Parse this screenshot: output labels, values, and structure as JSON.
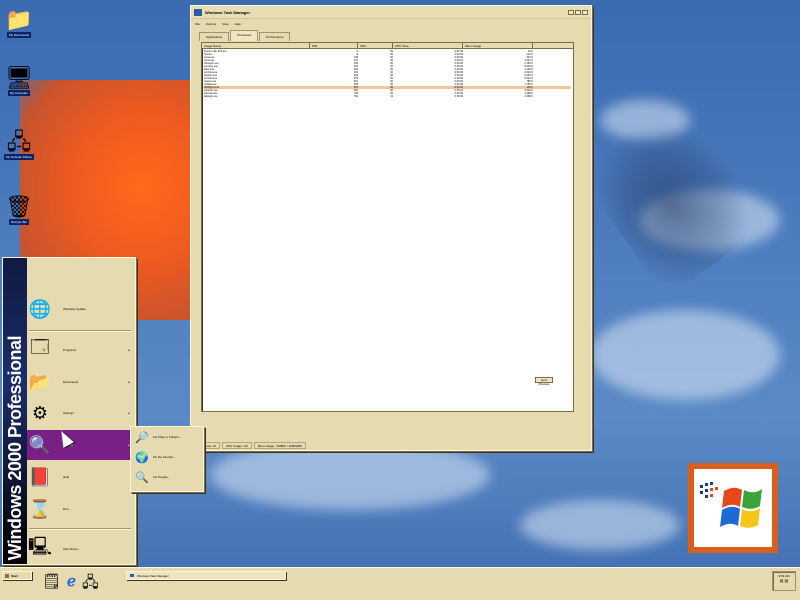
{
  "desktop": {
    "icons": [
      {
        "icon": "folder-icon",
        "glyph": "📁",
        "label": "My Documents"
      },
      {
        "icon": "computer-icon",
        "glyph": "🖥",
        "label": "My Computer"
      },
      {
        "icon": "network-icon",
        "glyph": "🖧",
        "label": "My Network Places"
      },
      {
        "icon": "recycle-bin-icon",
        "glyph": "🗑",
        "label": "Recycle Bin"
      }
    ]
  },
  "window": {
    "title": "Windows Task Manager",
    "menu": [
      "File",
      "Options",
      "View",
      "Help"
    ],
    "tabs": [
      "Applications",
      "Processes",
      "Performance"
    ],
    "columns": [
      "Image Name",
      "PID",
      "CPU",
      "CPU Time",
      "Mem Usage"
    ],
    "processes": [
      {
        "name": "System Idle Process",
        "pid": "0",
        "cpu": "99",
        "time": "0:01:58",
        "mem": "16 K"
      },
      {
        "name": "System",
        "pid": "8",
        "cpu": "00",
        "time": "0:00:02",
        "mem": "212 K"
      },
      {
        "name": "smss.exe",
        "pid": "148",
        "cpu": "00",
        "time": "0:00:00",
        "mem": "344 K"
      },
      {
        "name": "csrss.exe",
        "pid": "172",
        "cpu": "00",
        "time": "0:00:01",
        "mem": "1,424 K"
      },
      {
        "name": "winlogon.exe",
        "pid": "192",
        "cpu": "00",
        "time": "0:00:00",
        "mem": "2,184 K"
      },
      {
        "name": "services.exe",
        "pid": "220",
        "cpu": "00",
        "time": "0:00:00",
        "mem": "5,604 K"
      },
      {
        "name": "lsass.exe",
        "pid": "232",
        "cpu": "00",
        "time": "0:00:00",
        "mem": "1,136 K"
      },
      {
        "name": "svchost.exe",
        "pid": "400",
        "cpu": "00",
        "time": "0:00:00",
        "mem": "3,044 K"
      },
      {
        "name": "spoolsv.exe",
        "pid": "432",
        "cpu": "00",
        "time": "0:00:00",
        "mem": "3,264 K"
      },
      {
        "name": "svchost.exe",
        "pid": "476",
        "cpu": "00",
        "time": "0:00:00",
        "mem": "5,524 K"
      },
      {
        "name": "regsvc.exe",
        "pid": "512",
        "cpu": "00",
        "time": "0:00:00",
        "mem": "780 K"
      },
      {
        "name": "mstask.exe",
        "pid": "528",
        "cpu": "00",
        "time": "0:00:00",
        "mem": "1,756 K"
      },
      {
        "name": "WinMgmt.exe",
        "pid": "576",
        "cpu": "00",
        "time": "0:00:00",
        "mem": "136 K"
      },
      {
        "name": "explorer.exe",
        "pid": "640",
        "cpu": "00",
        "time": "0:00:01",
        "mem": "3,644 K"
      },
      {
        "name": "internat.exe",
        "pid": "736",
        "cpu": "00",
        "time": "0:00:00",
        "mem": "1,368 K"
      },
      {
        "name": "taskmgr.exe",
        "pid": "752",
        "cpu": "01",
        "time": "0:00:00",
        "mem": "2,008 K"
      }
    ],
    "end_process_label": "End Process",
    "status": [
      "Processes: 16",
      "CPU Usage: 1%",
      "Mem Usage: 74080K / 1180328K"
    ]
  },
  "start_menu": {
    "banner": "Windows 2000 Professional",
    "items": [
      {
        "icon": "windows-update-icon",
        "glyph": "🌐",
        "label": "Windows Update",
        "arrow": ""
      },
      {
        "icon": "programs-icon",
        "glyph": "🗔",
        "label": "Programs",
        "arrow": "▸"
      },
      {
        "icon": "documents-icon",
        "glyph": "📂",
        "label": "Documents",
        "arrow": "▸"
      },
      {
        "icon": "settings-icon",
        "glyph": "⚙",
        "label": "Settings",
        "arrow": "▸"
      },
      {
        "icon": "search-icon",
        "glyph": "🔍",
        "label": "Search",
        "arrow": "▸"
      },
      {
        "icon": "help-icon",
        "glyph": "📕",
        "label": "Help",
        "arrow": ""
      },
      {
        "icon": "run-icon",
        "glyph": "⌛",
        "label": "Run...",
        "arrow": ""
      },
      {
        "icon": "shutdown-icon",
        "glyph": "🖳",
        "label": "Shut Down...",
        "arrow": ""
      }
    ],
    "search_submenu": [
      {
        "icon": "search-files-icon",
        "glyph": "🔎",
        "label": "For Files or Folders..."
      },
      {
        "icon": "search-internet-icon",
        "glyph": "🌍",
        "label": "On the Internet..."
      },
      {
        "icon": "search-people-icon",
        "glyph": "🔍",
        "label": "For People..."
      }
    ]
  },
  "taskbar": {
    "start_label": "Start",
    "quick_launch": [
      {
        "icon": "desktop-icon",
        "glyph": "🗒"
      },
      {
        "icon": "ie-icon",
        "glyph": "ℯ"
      },
      {
        "icon": "outlook-icon",
        "glyph": "🖧"
      }
    ],
    "task_label": "Windows Task Manager",
    "clock": "9:53 AM"
  }
}
